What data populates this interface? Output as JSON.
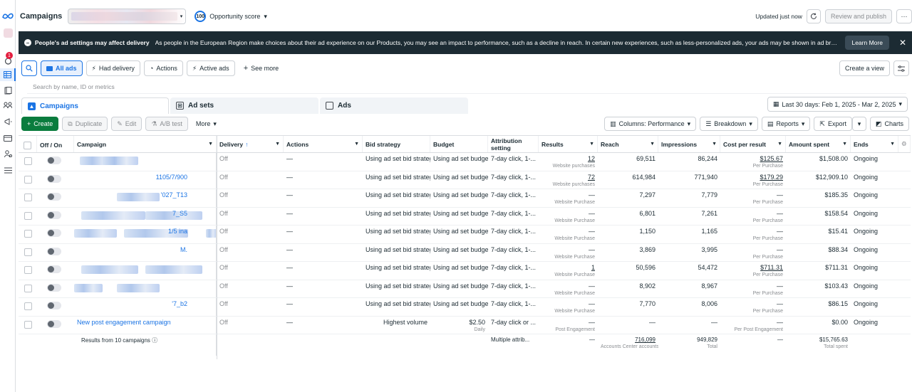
{
  "header": {
    "title": "Campaigns",
    "account_name": "",
    "opportunity_score": "100",
    "opportunity_label": "Opportunity score",
    "updated": "Updated just now",
    "review_publish": "Review and publish",
    "more_label": "···"
  },
  "rail": {
    "notification_count": "1"
  },
  "banner": {
    "title": "People's ad settings may affect delivery",
    "message": "As people in the European Region make choices about their ad experience on our Products, you may see an impact to performance, such as a decline in reach. In certain new experiences, such as less-personalized ads, your ads may be shown in ad breaks, in which people may need to ...",
    "learn_more": "Learn More"
  },
  "filters": {
    "all_ads": "All ads",
    "had_delivery": "Had delivery",
    "actions": "Actions",
    "active_ads": "Active ads",
    "see_more": "See more",
    "create_view": "Create a view"
  },
  "search": {
    "placeholder": "Search by name, ID or metrics"
  },
  "tabs": {
    "campaigns": "Campaigns",
    "ad_sets": "Ad sets",
    "ads": "Ads"
  },
  "date_range": "Last 30 days: Feb 1, 2025 - Mar 2, 2025",
  "toolbar": {
    "create": "Create",
    "duplicate": "Duplicate",
    "edit": "Edit",
    "ab_test": "A/B test",
    "more": "More",
    "columns": "Columns: Performance",
    "breakdown": "Breakdown",
    "reports": "Reports",
    "export": "Export",
    "charts": "Charts"
  },
  "columns": {
    "offon": "Off / On",
    "campaign": "Campaign",
    "delivery": "Delivery",
    "actions": "Actions",
    "bid": "Bid strategy",
    "budget": "Budget",
    "attribution": "Attribution setting",
    "results": "Results",
    "reach": "Reach",
    "impressions": "Impressions",
    "cpr": "Cost per result",
    "amount": "Amount spent",
    "ends": "Ends"
  },
  "rows": [
    {
      "name": "",
      "delivery": "Off",
      "actions": "—",
      "bid": "Using ad set bid strategy",
      "budget": "Using ad set budget",
      "budget_sub": "",
      "attribution": "7-day click, 1-...",
      "results": "12",
      "results_sub": "Website purchases",
      "reach": "69,511",
      "impressions": "86,244",
      "cpr": "$125.67",
      "cpr_sub": "Per Purchase",
      "amount": "$1,508.00",
      "ends": "Ongoing"
    },
    {
      "name": "1105/7/900",
      "delivery": "Off",
      "actions": "—",
      "bid": "Using ad set bid strategy",
      "budget": "Using ad set budget",
      "budget_sub": "",
      "attribution": "7-day click, 1-...",
      "results": "72",
      "results_sub": "Website purchases",
      "reach": "614,984",
      "impressions": "771,940",
      "cpr": "$179.29",
      "cpr_sub": "Per Purchase",
      "amount": "$12,909.10",
      "ends": "Ongoing"
    },
    {
      "name": "'027_T13",
      "delivery": "Off",
      "actions": "—",
      "bid": "Using ad set bid strategy",
      "budget": "Using ad set budget",
      "budget_sub": "",
      "attribution": "7-day click, 1-...",
      "results": "—",
      "results_sub": "Website Purchase",
      "reach": "7,297",
      "impressions": "7,779",
      "cpr": "—",
      "cpr_sub": "Per Purchase",
      "amount": "$185.35",
      "ends": "Ongoing"
    },
    {
      "name": "7_S5",
      "delivery": "Off",
      "actions": "—",
      "bid": "Using ad set bid strategy",
      "budget": "Using ad set budget",
      "budget_sub": "",
      "attribution": "7-day click, 1-...",
      "results": "—",
      "results_sub": "Website Purchase",
      "reach": "6,801",
      "impressions": "7,261",
      "cpr": "—",
      "cpr_sub": "Per Purchase",
      "amount": "$158.54",
      "ends": "Ongoing"
    },
    {
      "name": "1/5 ina",
      "delivery": "Off",
      "actions": "—",
      "bid": "Using ad set bid strategy",
      "budget": "Using ad set budget",
      "budget_sub": "",
      "attribution": "7-day click, 1-...",
      "results": "—",
      "results_sub": "Website Purchase",
      "reach": "1,150",
      "impressions": "1,165",
      "cpr": "—",
      "cpr_sub": "Per Purchase",
      "amount": "$15.41",
      "ends": "Ongoing"
    },
    {
      "name": "M.",
      "delivery": "Off",
      "actions": "—",
      "bid": "Using ad set bid strategy",
      "budget": "Using ad set budget",
      "budget_sub": "",
      "attribution": "7-day click, 1-...",
      "results": "—",
      "results_sub": "Website Purchase",
      "reach": "3,869",
      "impressions": "3,995",
      "cpr": "—",
      "cpr_sub": "Per Purchase",
      "amount": "$88.34",
      "ends": "Ongoing"
    },
    {
      "name": "",
      "delivery": "Off",
      "actions": "—",
      "bid": "Using ad set bid strategy",
      "budget": "Using ad set budget",
      "budget_sub": "",
      "attribution": "7-day click, 1-...",
      "results": "1",
      "results_sub": "Website Purchase",
      "reach": "50,596",
      "impressions": "54,472",
      "cpr": "$711.31",
      "cpr_sub": "Per Purchase",
      "amount": "$711.31",
      "ends": "Ongoing"
    },
    {
      "name": "",
      "delivery": "Off",
      "actions": "—",
      "bid": "Using ad set bid strategy",
      "budget": "Using ad set budget",
      "budget_sub": "",
      "attribution": "7-day click, 1-...",
      "results": "—",
      "results_sub": "Website Purchase",
      "reach": "8,902",
      "impressions": "8,967",
      "cpr": "—",
      "cpr_sub": "Per Purchase",
      "amount": "$103.43",
      "ends": "Ongoing"
    },
    {
      "name": "'7_b2",
      "delivery": "Off",
      "actions": "—",
      "bid": "Using ad set bid strategy",
      "budget": "Using ad set budget",
      "budget_sub": "",
      "attribution": "7-day click, 1-...",
      "results": "—",
      "results_sub": "Website Purchase",
      "reach": "7,770",
      "impressions": "8,006",
      "cpr": "—",
      "cpr_sub": "Per Purchase",
      "amount": "$86.15",
      "ends": "Ongoing"
    },
    {
      "name": "New post engagement campaign",
      "delivery": "Off",
      "actions": "—",
      "bid": "Highest volume",
      "budget": "$2.50",
      "budget_sub": "Daily",
      "attribution": "7-day click or ...",
      "results": "—",
      "results_sub": "Post Engagement",
      "reach": "—",
      "impressions": "—",
      "cpr": "—",
      "cpr_sub": "Per Post Engagement",
      "amount": "$0.00",
      "ends": "Ongoing"
    }
  ],
  "footer": {
    "label": "Results from 10 campaigns",
    "attribution": "Multiple attrib...",
    "results": "—",
    "reach": "716,099",
    "reach_sub": "Accounts Center accounts",
    "impressions": "949,829",
    "impressions_sub": "Total",
    "cpr": "—",
    "amount": "$15,765.63",
    "amount_sub": "Total spent"
  },
  "colors": {
    "accent": "#1b74e4",
    "create_green": "#0a7c3e",
    "banner_bg": "#1c2b33"
  }
}
